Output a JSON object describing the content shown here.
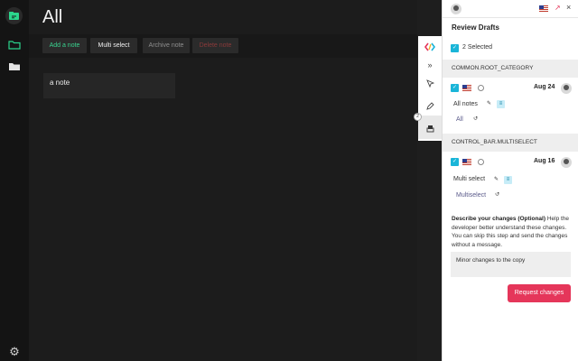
{
  "app": {
    "page_title": "All",
    "toolbar": {
      "add_label": "Add a note",
      "multi_label": "Multi select",
      "archive_label": "Archive note",
      "delete_label": "Delete note"
    },
    "note": {
      "text": "a note"
    },
    "rail": {
      "logo_icon": "note-app-logo-icon",
      "folder_selected_icon": "folder-outline-icon",
      "folder_icon": "folder-filled-icon",
      "settings_icon": "gear-icon"
    }
  },
  "side_toolbar": {
    "logo_icon": "code-brackets-icon",
    "expand_icon": "chevron-double-right-icon",
    "pointer_icon": "cursor-icon",
    "edit_icon": "pencil-icon",
    "drafts_icon": "stack-icon",
    "badge": "2"
  },
  "panel": {
    "title": "Review Drafts",
    "selected_text": "2 Selected",
    "groups": [
      {
        "category": "COMMON.ROOT_CATEGORY",
        "date": "Aug 24",
        "label": "All notes",
        "translation": "All"
      },
      {
        "category": "CONTROL_BAR.MULTISELECT",
        "date": "Aug 16",
        "label": "Multi select",
        "translation": "Multiselect"
      }
    ],
    "describe_bold": "Describe your changes (Optional)",
    "describe_text": " Help the developer better understand these changes. You can skip this step and send the changes without a message.",
    "message": "Minor changes to the copy",
    "request_label": "Request changes"
  },
  "colors": {
    "accent_green": "#3ad38f",
    "check_blue": "#1ab5d8",
    "request_pink": "#e5365a"
  }
}
